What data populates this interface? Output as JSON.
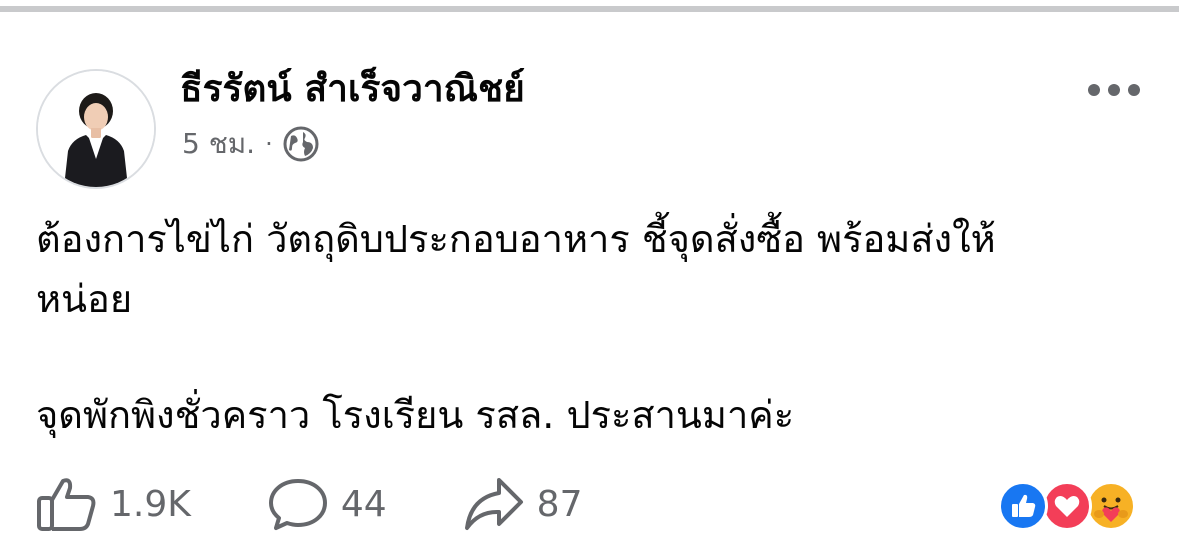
{
  "post": {
    "author": "ธีรรัตน์ สำเร็จวาณิชย์",
    "time": "5 ชม.",
    "separator": "·",
    "privacy_icon": "globe-icon",
    "more_icon": "more-horizontal-icon",
    "text_lines": [
      "ต้องการไข่ไก่ วัตถุดิบประกอบอาหาร ชี้จุดสั่งซื้อ พร้อมส่งให้",
      "หน่อย",
      "จุดพักพิงชั่วคราว โรงเรียน รสล. ประสานมาค่ะ"
    ]
  },
  "actions": {
    "like_count": "1.9K",
    "comment_count": "44",
    "share_count": "87"
  },
  "reactions": [
    "like-reaction-icon",
    "love-reaction-icon",
    "care-reaction-icon"
  ],
  "colors": {
    "secondary_text": "#65676b",
    "like_blue": "#1877f2",
    "love_red": "#f33e58",
    "care_yellow": "#f7b125"
  }
}
